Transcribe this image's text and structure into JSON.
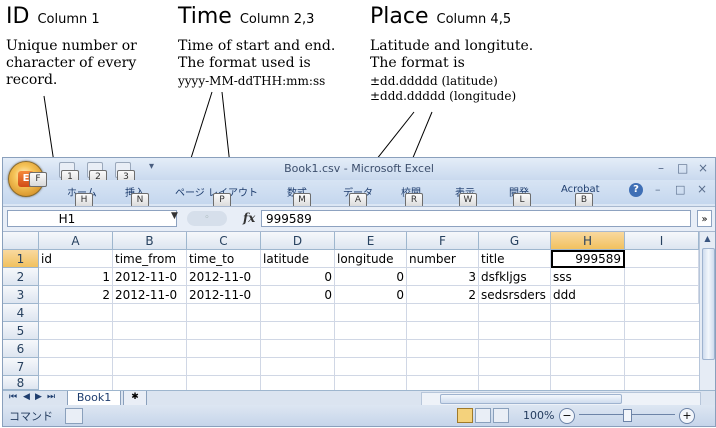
{
  "annotations": {
    "id": {
      "title": "ID",
      "column": "Column 1",
      "lines": [
        "Unique number or",
        "character of every",
        "record."
      ]
    },
    "time": {
      "title": "Time",
      "column": "Column 2,3",
      "lines": [
        "Time of start and end.",
        "The format used is"
      ],
      "format": "yyyy-MM-ddTHH:mm:ss"
    },
    "place": {
      "title": "Place",
      "column": "Column 4,5",
      "lines": [
        "Latitude and longitute.",
        "The format is"
      ],
      "formats": [
        "±dd.ddddd (latitude)",
        "±ddd.ddddd (longitude)"
      ]
    }
  },
  "window": {
    "title": "Book1.csv - Microsoft Excel",
    "office_logo": "E",
    "qat_keytips": [
      "1",
      "2",
      "3"
    ],
    "office_keytip": "F",
    "controls": {
      "minimize": "–",
      "restore": "□",
      "close": "×"
    }
  },
  "ribbon": {
    "tabs": [
      {
        "label": "ホーム",
        "keytip": "H"
      },
      {
        "label": "挿入",
        "keytip": "N"
      },
      {
        "label": "ページ レイアウト",
        "keytip": "P"
      },
      {
        "label": "数式",
        "keytip": "M"
      },
      {
        "label": "データ",
        "keytip": "A"
      },
      {
        "label": "校閲",
        "keytip": "R"
      },
      {
        "label": "表示",
        "keytip": "W"
      },
      {
        "label": "開発",
        "keytip": "L"
      },
      {
        "label": "Acrobat",
        "keytip": "B"
      }
    ],
    "help_icon": "help-icon"
  },
  "formula_bar": {
    "name_box": "H1",
    "fx_label": "fx",
    "value": "999589"
  },
  "columns": [
    "A",
    "B",
    "C",
    "D",
    "E",
    "F",
    "G",
    "H",
    "I"
  ],
  "rows": [
    "1",
    "2",
    "3",
    "4",
    "5",
    "6",
    "7",
    "8"
  ],
  "cells": {
    "r1": [
      "id",
      "time_from",
      "time_to",
      "latitude",
      "longitude",
      "number",
      "title",
      "999589",
      ""
    ],
    "r2": [
      "1",
      "2012-11-0",
      "2012-11-0",
      "0",
      "0",
      "3",
      "dsfkljgs",
      "sss",
      ""
    ],
    "r3": [
      "2",
      "2012-11-0",
      "2012-11-0",
      "0",
      "0",
      "2",
      "sedsrsders",
      "ddd",
      ""
    ]
  },
  "sheet_tabs": {
    "nav": [
      "⏮",
      "◀",
      "▶",
      "⏭"
    ],
    "tab": "Book1"
  },
  "status_bar": {
    "mode": "コマンド",
    "zoom": "100%",
    "zoom_out": "−",
    "zoom_in": "+"
  },
  "colors": {
    "accent": "#f1c15f",
    "window_border": "#8aa0bc",
    "header_border": "#9eb6ce"
  }
}
